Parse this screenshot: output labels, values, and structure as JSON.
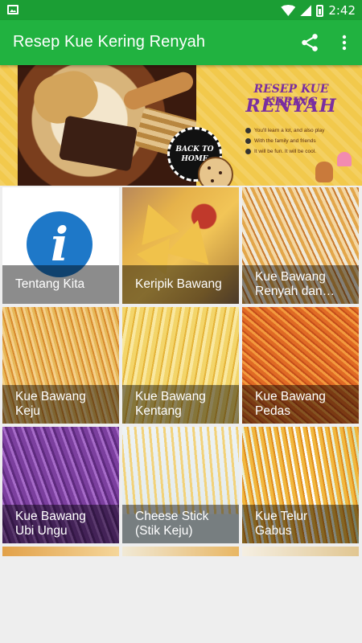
{
  "statusbar": {
    "time": "2:42"
  },
  "appbar": {
    "title": "Resep Kue Kering Renyah"
  },
  "banner": {
    "headline_line1": "RESEP KUE KERING",
    "headline_line2": "RENYAH",
    "back_button": "BACK TO HOME",
    "bullets": [
      "You'll learn a lot, and also play",
      "With the family and friends",
      "It will be fun. It will be cool."
    ]
  },
  "grid": {
    "items": [
      {
        "label": "Tentang Kita"
      },
      {
        "label": "Keripik Bawang"
      },
      {
        "label": "Kue Bawang Renyah dan…"
      },
      {
        "label": "Kue Bawang Keju"
      },
      {
        "label": "Kue Bawang Kentang"
      },
      {
        "label": "Kue Bawang Pedas"
      },
      {
        "label": "Kue Bawang Ubi Ungu"
      },
      {
        "label": "Cheese Stick (Stik Keju)"
      },
      {
        "label": "Kue Telur Gabus"
      }
    ]
  },
  "colors": {
    "statusbar": "#1b9e34",
    "appbar": "#21b240",
    "banner_bg": "#f2c94c",
    "headline": "#7a2ea0",
    "info_icon": "#1e78c8"
  }
}
